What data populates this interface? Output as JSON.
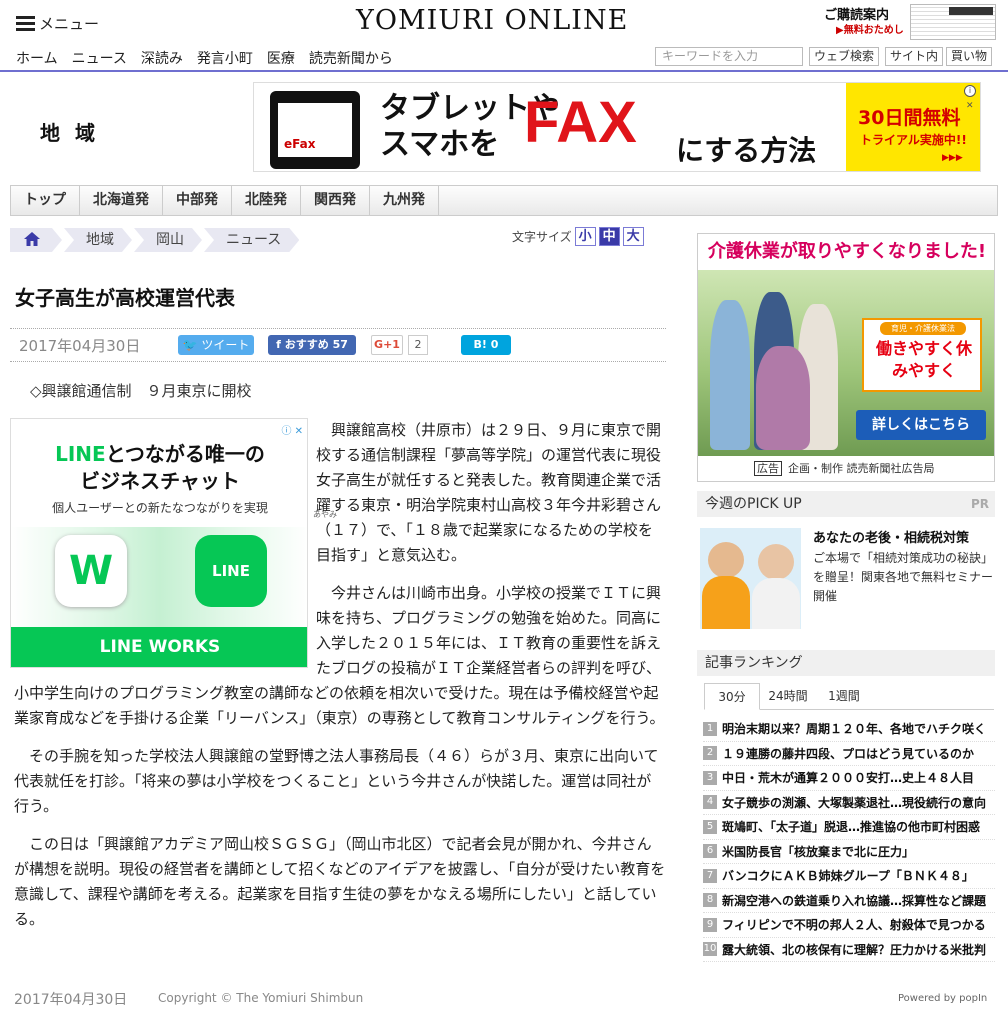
{
  "header": {
    "menu_label": "メニュー",
    "logo": "YOMIURI ONLINE",
    "subscribe": "ご購読案内",
    "subscribe_sub": "▶無料おためし"
  },
  "nav": {
    "links": [
      "ホーム",
      "ニュース",
      "深読み",
      "発言小町",
      "医療",
      "読売新聞から"
    ],
    "search_placeholder": "キーワードを入力",
    "buttons": [
      "ウェブ検索",
      "サイト内",
      "買い物"
    ]
  },
  "region_title": "地 域",
  "banner_ad": {
    "brand": "eFax",
    "copy_line1": "タブレットや",
    "copy_line2": "スマホを",
    "big": "FAX",
    "tail": "にする方法",
    "offer1": "30日間無料",
    "offer2": "トライアル実施中!!",
    "arrows": "▶▶▶"
  },
  "region_tabs": [
    "トップ",
    "北海道発",
    "中部発",
    "北陸発",
    "関西発",
    "九州発"
  ],
  "breadcrumb": [
    "地域",
    "岡山",
    "ニュース"
  ],
  "font_size": {
    "label": "文字サイズ",
    "options": [
      "小",
      "中",
      "大"
    ]
  },
  "article": {
    "title": "女子高生が高校運営代表",
    "date": "2017年04月30日",
    "share": {
      "tweet": "ツイート",
      "facebook": "おすすめ 57",
      "gplus": "G+1",
      "gplus_count": "2",
      "hatena": "B! 0"
    },
    "lead": "◇興譲館通信制　９月東京に開校",
    "ruby": "あやみ",
    "paragraphs": [
      "興譲館高校（井原市）は２９日、９月に東京で開校する通信制課程「夢高等学院」の運営代表に現役女子高生が就任すると発表した。教育関連企業で活躍する東京・明治学院東村山高校３年今井彩碧さん（１７）で、「１８歳で起業家になるための学校を目指す」と意気込む。",
      "今井さんは川崎市出身。小学校の授業でＩＴに興味を持ち、プログラミングの勉強を始めた。同高に入学した２０１５年には、ＩＴ教育の重要性を訴えたブログの投稿がＩＴ企業経営者らの評判を呼び、小中学生向けのプログラミング教室の講師などの依頼を相次いで受けた。現在は予備校経営や起業家育成などを手掛ける企業「リーバンス」（東京）の専務として教育コンサルティングを行う。",
      "その手腕を知った学校法人興譲館の堂野博之法人事務局長（４６）らが３月、東京に出向いて代表就任を打診。「将来の夢は小学校をつくること」という今井さんが快諾した。運営は同社が行う。",
      "この日は「興譲館アカデミア岡山校ＳＧＳＧ」（岡山市北区）で記者会見が開かれ、今井さんが構想を説明。現役の経営者を講師として招くなどのアイデアを披露し、「自分が受けたい教育を意識して、課程や講師を考える。起業家を目指す生徒の夢をかなえる場所にしたい」と話している。"
    ],
    "footer_date": "2017年04月30日",
    "copyright": "Copyright © The Yomiuri Shimbun"
  },
  "line_ad": {
    "headline_line1_green": "LINE",
    "headline_line1_rest": "とつながる唯一の",
    "headline_line2": "ビジネスチャット",
    "sub": "個人ユーザーとの新たなつながりを実現",
    "w_icon": "W",
    "line_icon": "LINE",
    "footer": "LINE WORKS",
    "adchoice": "ⓘ ✕"
  },
  "side_ad": {
    "title": "介護休業が取りやすくなりました!",
    "badge_label": "育児・介護休業法",
    "badge_text": "働きやすく休みやすく",
    "button": "詳しくはこちら",
    "credit_tag": "広告",
    "credit": "企画・制作 読売新聞社広告局"
  },
  "pickup": {
    "header": "今週のPICK UP",
    "pr": "PR",
    "title": "あなたの老後・相続税対策",
    "desc": "ご本場で「相続対策成功の秘訣」を贈呈！関東各地で無料セミナー開催"
  },
  "ranking": {
    "header": "記事ランキング",
    "tabs": [
      "30分",
      "24時間",
      "1週間"
    ],
    "items": [
      "明治末期以来？周期１２０年、各地でハチク咲く",
      "１９連勝の藤井四段、プロはどう見ているのか",
      "中日・荒木が通算２０００安打…史上４８人目",
      "女子競歩の渕瀬、大塚製薬退社…現役続行の意向",
      "斑鳩町、「太子道」脱退…推進協の他市町村困惑",
      "米国防長官「核放棄まで北に圧力」",
      "バンコクにＡＫＢ姉妹グループ「ＢＮＫ４８」",
      "新潟空港への鉄道乗り入れ協議…採算性など課題",
      "フィリピンで不明の邦人２人、射殺体で見つかる",
      "露大統領、北の核保有に理解？圧力かける米批判"
    ],
    "powered": "Powered by popIn"
  }
}
